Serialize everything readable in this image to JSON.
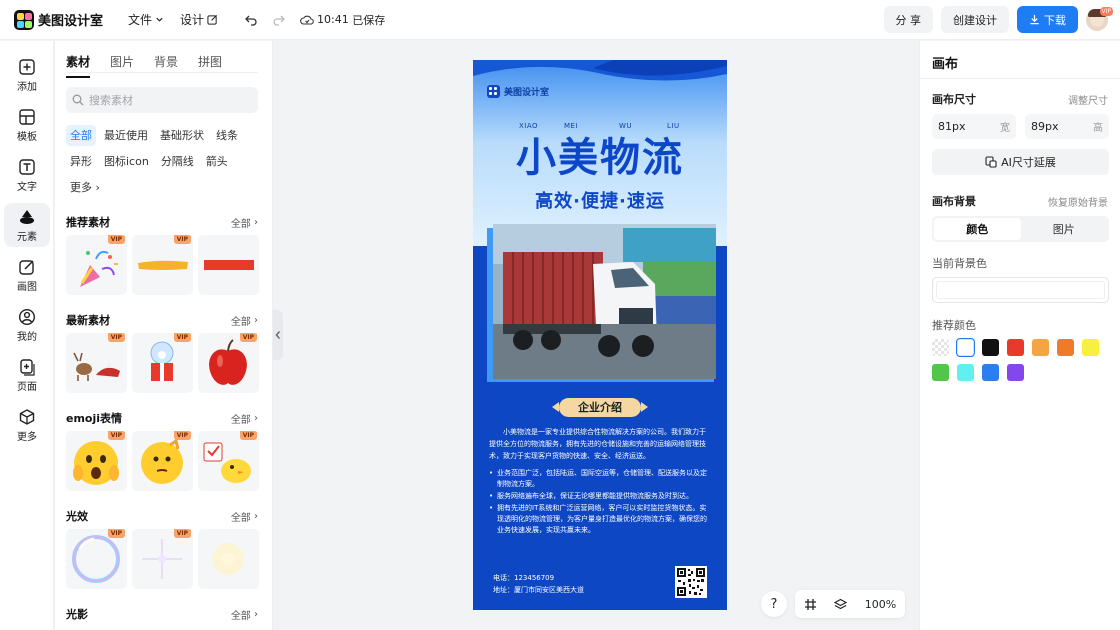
{
  "app": {
    "name": "美图设计室",
    "menus": [
      "文件",
      "设计"
    ],
    "save_time": "10:41",
    "save_status": "已保存",
    "share_label": "分 享",
    "create_label": "创建设计",
    "download_label": "下载",
    "avatar_badge": "VIP"
  },
  "rail": [
    {
      "label": "添加",
      "icon": "plus-square-icon"
    },
    {
      "label": "模板",
      "icon": "template-icon"
    },
    {
      "label": "文字",
      "icon": "text-icon"
    },
    {
      "label": "元素",
      "icon": "shapes-icon",
      "active": true
    },
    {
      "label": "画图",
      "icon": "draw-icon"
    },
    {
      "label": "我的",
      "icon": "user-icon"
    },
    {
      "label": "页面",
      "icon": "add-page-icon"
    },
    {
      "label": "更多",
      "icon": "cube-icon"
    }
  ],
  "panel": {
    "tabs": [
      "素材",
      "图片",
      "背景",
      "拼图"
    ],
    "active_tab": "素材",
    "search_placeholder": "搜索素材",
    "chips": [
      "全部",
      "最近使用",
      "基础形状",
      "线条",
      "异形",
      "图标icon",
      "分隔线",
      "箭头",
      "更多"
    ],
    "active_chip": "全部",
    "all_label": "全部",
    "vip_label": "VIP",
    "sections": [
      {
        "title": "推荐素材",
        "items": [
          "party-popper",
          "yellow-brush-stroke",
          "red-bar"
        ],
        "vip": [
          true,
          true,
          false
        ]
      },
      {
        "title": "最新素材",
        "items": [
          "reindeer-sleigh",
          "snow-globe-gift",
          "red-apple"
        ],
        "vip": [
          true,
          true,
          true
        ]
      },
      {
        "title": "emoji表情",
        "items": [
          "shocked-emoji",
          "thinking-emoji",
          "chick-emoji"
        ],
        "vip": [
          true,
          true,
          true
        ]
      },
      {
        "title": "光效",
        "items": [
          "bubble-ring",
          "star-flare",
          "glow"
        ],
        "vip": [
          true,
          true,
          false
        ]
      },
      {
        "title": "光影",
        "items": [],
        "vip": []
      }
    ]
  },
  "poster": {
    "brand": "美图设计室",
    "pinyin": [
      "XIAO",
      "MEI",
      "WU",
      "LIU"
    ],
    "title": "小美物流",
    "subtitle": "高效·便捷·速运",
    "intro_heading": "企业介绍",
    "intro": "小美物流是一家专业提供综合性物流解决方案的公司。我们致力于提供全方位的物流服务，拥有先进的仓储设施和完善的运输网络管理技术，致力于实现客户货物的快速、安全、经济运送。",
    "bullets": [
      "业务范围广泛，包括陆运、国际空运等，仓储管理、配送服务以及定制物流方案。",
      "服务网络遍布全球，保证无论哪里都能提供物流服务及时到达。",
      "拥有先进的IT系统和广泛运营网络，客户可以实时监控货物状态。实现透明化的物流管理，为客户量身打造最优化的物流方案，确保您的业务快速发展，实现共赢未来。"
    ],
    "phone": "电话：123456709",
    "address": "地址：厦门市同安区美西大道"
  },
  "toolbar": {
    "help": "?",
    "zoom": "100%"
  },
  "right": {
    "title": "画布",
    "size_label": "画布尺寸",
    "adjust_label": "调整尺寸",
    "width_value": "81px",
    "width_unit": "宽",
    "height_value": "89px",
    "height_unit": "高",
    "ai_extend": "AI尺寸延展",
    "bg_label": "画布背景",
    "restore_label": "恢复原始背景",
    "bg_tabs": [
      "颜色",
      "图片"
    ],
    "current_bg_label": "当前背景色",
    "recommend_label": "推荐颜色",
    "swatches": [
      "transparent",
      "#ffffff",
      "#111111",
      "#e8392c",
      "#f5a443",
      "#ef7a29",
      "#f8ef3f",
      "#52c64a",
      "#5ff0ef",
      "#2a7ef0",
      "#8447ee"
    ]
  },
  "colors": {
    "accent": "#1e7cf5",
    "poster_blue": "#0e47c4",
    "vip": "#f7a46b"
  }
}
